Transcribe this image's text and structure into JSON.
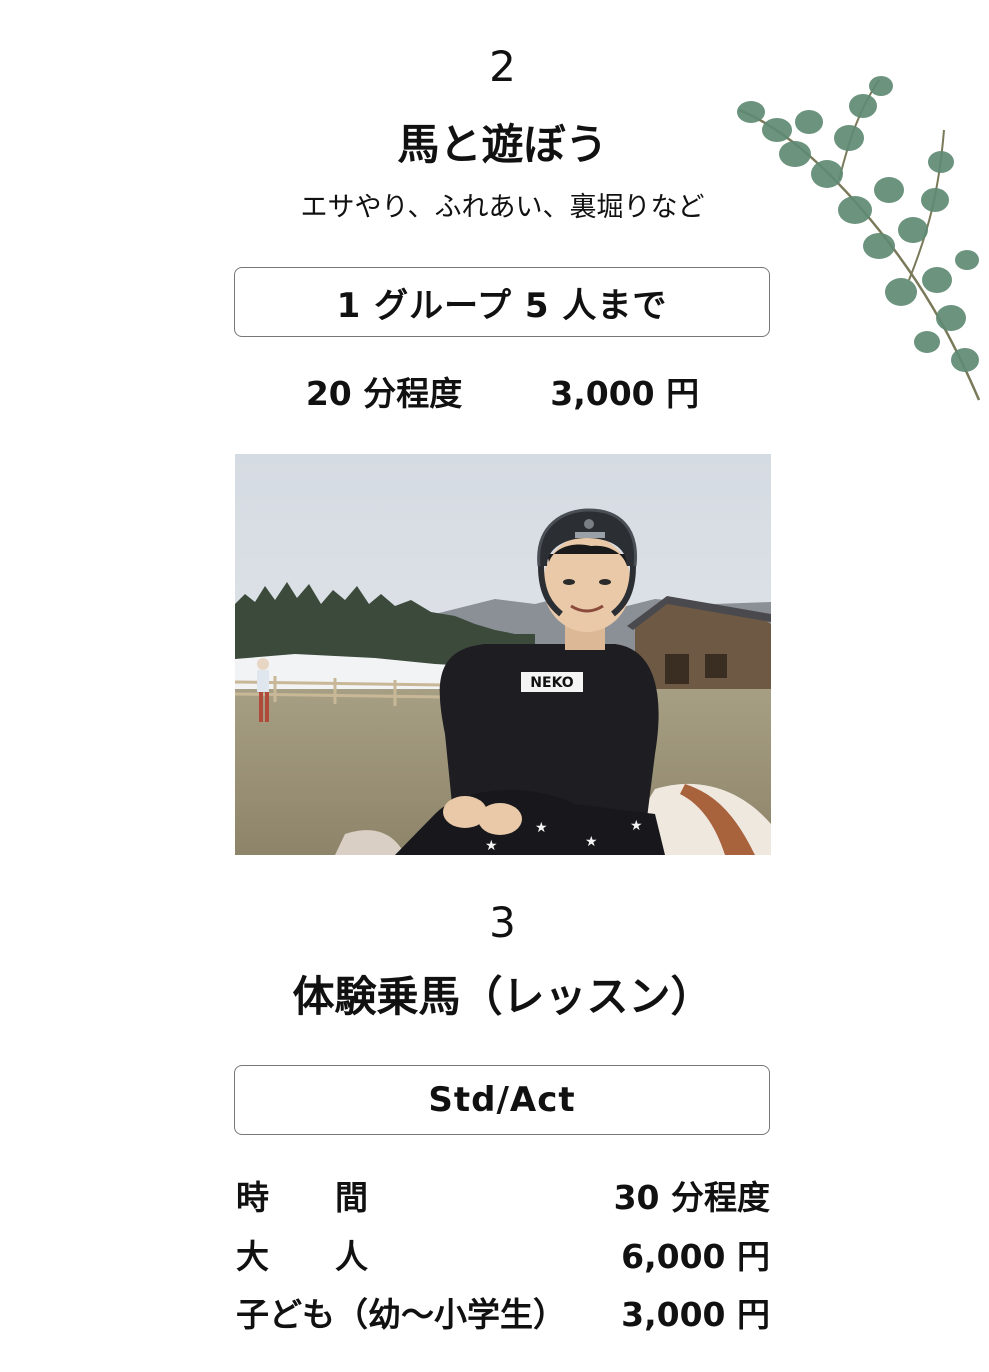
{
  "section2": {
    "number": "2",
    "title": "馬と遊ぼう",
    "subtitle": "エサやり、ふれあい、裏堀りなど",
    "box_text": "1 グループ 5 人まで",
    "duration": "20 分程度",
    "price": "3,000 円"
  },
  "photo": {
    "shirt_text": "NEKO"
  },
  "section3": {
    "number": "3",
    "title": "体験乗馬（レッスン）",
    "box_text": "Std/Act",
    "rows": [
      {
        "label": "時　　間",
        "value": "30 分程度"
      },
      {
        "label": "大　　人",
        "value": "6,000 円"
      },
      {
        "label": "子ども（幼～小学生）",
        "value": "3,000 円"
      }
    ]
  },
  "colors": {
    "leaf": "#5f8a74",
    "stem": "#7a7a5a",
    "box_border": "#777777"
  }
}
